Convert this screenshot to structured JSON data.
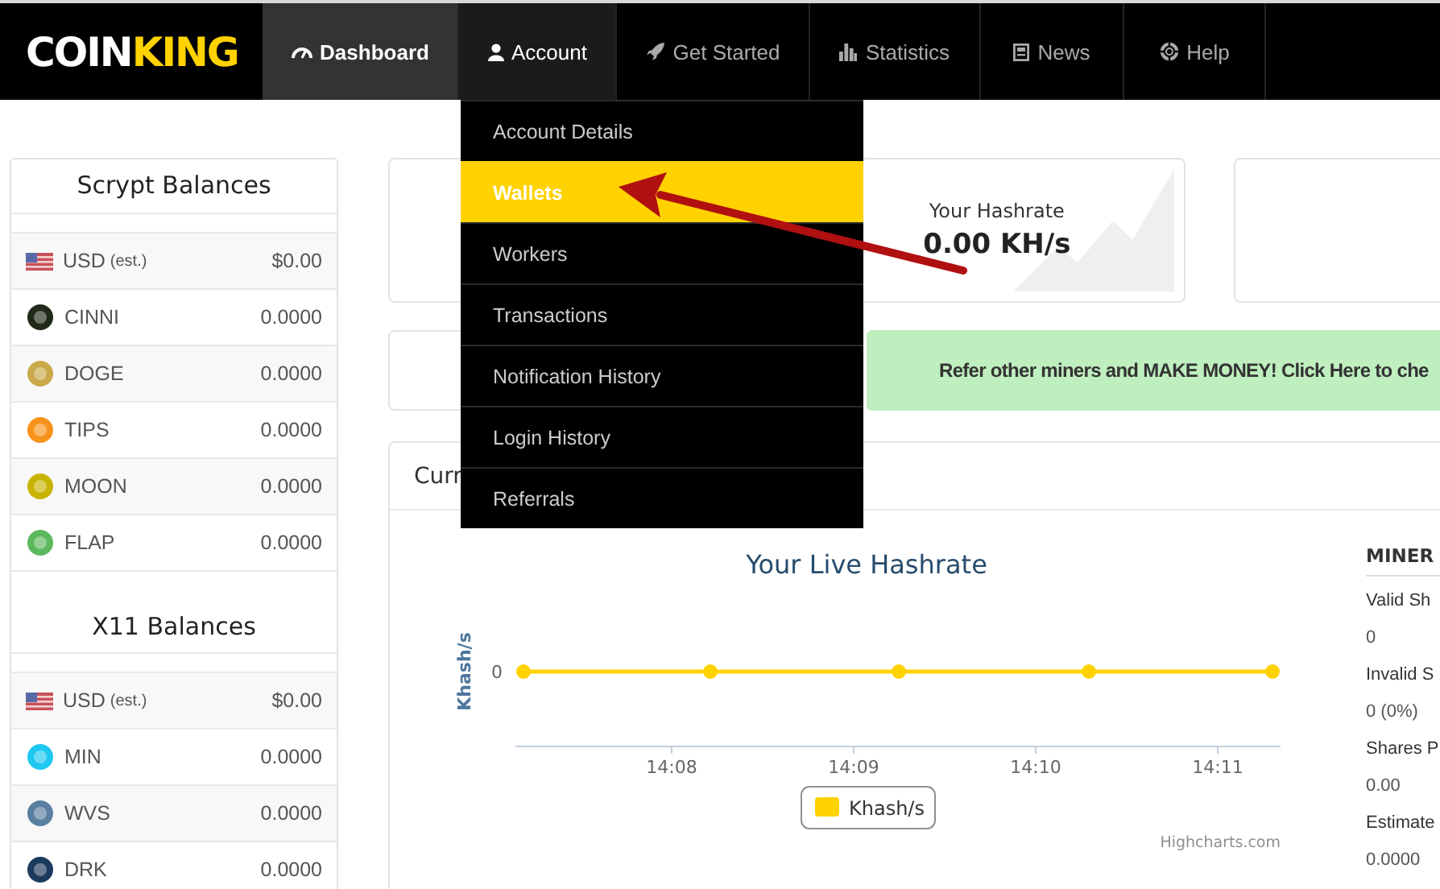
{
  "logo": {
    "parts": [
      {
        "text": "COIN",
        "accent": false
      },
      {
        "text": "KING",
        "accent": true
      }
    ]
  },
  "nav": {
    "items": [
      {
        "label": "Dashboard",
        "selected": true,
        "expanded": false
      },
      {
        "label": "Account",
        "selected": false,
        "expanded": true
      },
      {
        "label": "Get Started",
        "selected": false,
        "expanded": false
      },
      {
        "label": "Statistics",
        "selected": false,
        "expanded": false
      },
      {
        "label": "News",
        "selected": false,
        "expanded": false
      },
      {
        "label": "Help",
        "selected": false,
        "expanded": false
      }
    ]
  },
  "account_menu": {
    "items": [
      {
        "label": "Account Details",
        "selected": false
      },
      {
        "label": "Wallets",
        "selected": true
      },
      {
        "label": "Workers",
        "selected": false
      },
      {
        "label": "Transactions",
        "selected": false
      },
      {
        "label": "Notification History",
        "selected": false
      },
      {
        "label": "Login History",
        "selected": false
      },
      {
        "label": "Referrals",
        "selected": false
      }
    ]
  },
  "balances": {
    "sections": [
      {
        "title": "Scrypt Balances",
        "rows": [
          {
            "kind": "fiat",
            "name": "USD",
            "note": "(est.)",
            "amount": "$0.00"
          },
          {
            "kind": "coin",
            "name": "CINNI",
            "color": "#1f2a18",
            "amount": "0.0000"
          },
          {
            "kind": "coin",
            "name": "DOGE",
            "color": "#c9a94a",
            "amount": "0.0000"
          },
          {
            "kind": "coin",
            "name": "TIPS",
            "color": "#f7931a",
            "amount": "0.0000"
          },
          {
            "kind": "coin",
            "name": "MOON",
            "color": "#c8b400",
            "amount": "0.0000"
          },
          {
            "kind": "coin",
            "name": "FLAP",
            "color": "#5cb85c",
            "amount": "0.0000"
          }
        ]
      },
      {
        "title": "X11 Balances",
        "rows": [
          {
            "kind": "fiat",
            "name": "USD",
            "note": "(est.)",
            "amount": "$0.00"
          },
          {
            "kind": "coin",
            "name": "MIN",
            "color": "#1ec8f0",
            "amount": "0.0000"
          },
          {
            "kind": "coin",
            "name": "WVS",
            "color": "#5a7fa0",
            "amount": "0.0000"
          },
          {
            "kind": "coin",
            "name": "DRK",
            "color": "#1c3a5e",
            "amount": "0.0000"
          }
        ]
      }
    ]
  },
  "hashrate_card": {
    "label": "Your Hashrate",
    "value": "0.00 KH/s"
  },
  "referral_banner": {
    "text": "Refer other miners and MAKE MONEY! Click Here to che"
  },
  "panel": {
    "title": "Curr",
    "credit": "Highcharts.com",
    "chart": {
      "title": "Your Live Hashrate",
      "ylabel": "Khash/s",
      "y_tick": "0",
      "x_ticks": [
        "14:08",
        "14:09",
        "14:10",
        "14:11"
      ],
      "legend": "Khash/s"
    }
  },
  "miner_stats": {
    "title": "MINER",
    "items": [
      {
        "label": "Valid Sh",
        "value": "0"
      },
      {
        "label": "Invalid S",
        "value": "0 (0%)"
      },
      {
        "label": "Shares P",
        "value": "0.00"
      },
      {
        "label": "Estimate",
        "value": "0.0000"
      }
    ]
  }
}
